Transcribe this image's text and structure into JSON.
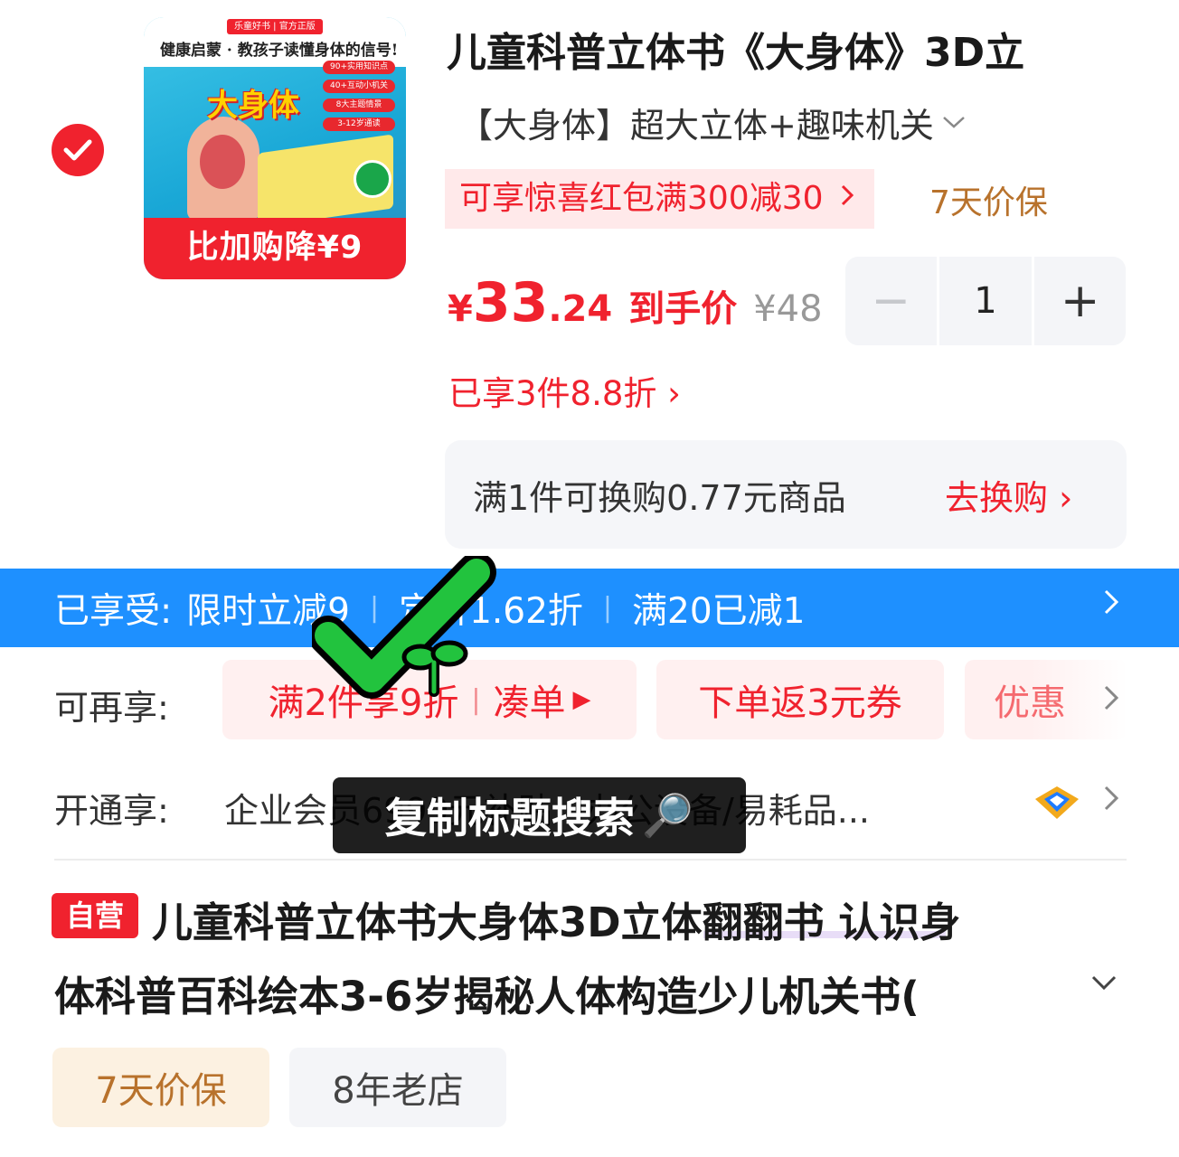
{
  "item": {
    "image": {
      "brand_badge": "乐童好书 | 官方正版",
      "tagline": "健康启蒙 · 教孩子读懂身体的信号!",
      "cover_title": "大身体",
      "tags": [
        "90+实用知识点",
        "40+互动小机关",
        "8大主题情景",
        "3-12岁通读"
      ],
      "banner": "比加购降¥9"
    },
    "title": "儿童科普立体书《大身体》3D立",
    "sku": "【大身体】超大立体+趣味机关",
    "red_packet": "可享惊喜红包满300减30",
    "price_protect": "7天价保",
    "price": {
      "symbol": "¥",
      "integer": "33",
      "decimal": ".24",
      "label": "到手价",
      "original": "¥48"
    },
    "quantity": {
      "minus": "−",
      "value": "1",
      "plus": "+"
    },
    "discount_link": "已享3件8.8折 ›",
    "exchange": {
      "text": "满1件可换购0.77元商品",
      "link": "去换购 ›"
    }
  },
  "enjoyed": {
    "label": "已享受:",
    "items": [
      "限时立减9",
      "定价1.62折",
      "满20已减1"
    ]
  },
  "more_offers": {
    "label": "可再享:",
    "chip1_main": "满2件享9折",
    "chip1_link": "凑单",
    "chip2": "下单返3元券",
    "chip3": "优惠"
  },
  "enterprise": {
    "label": "开通享:",
    "text": "企业会员6999元补贴 · 办公设备/易耗品..."
  },
  "toast": {
    "text": "复制标题搜索",
    "icon": "🔎"
  },
  "full_title": {
    "badge": "自营",
    "line1": "儿童科普立体书大身体3D立体翻翻书 认识身",
    "line2": "体科普百科绘本3-6岁揭秘人体构造少儿机关书("
  },
  "tags": {
    "price_protect": "7天价保",
    "shop_age": "8年老店"
  },
  "colors": {
    "accent_red": "#f0222e",
    "blue_bar": "#1e90ff",
    "gold": "#b8722c",
    "sticker_green": "#22c33e"
  }
}
